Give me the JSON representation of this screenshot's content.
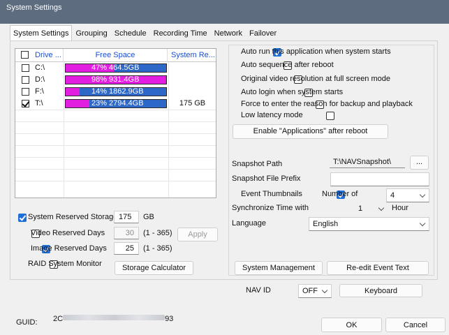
{
  "window": {
    "title": "System Settings"
  },
  "tabs": [
    {
      "label": "System Settings",
      "active": true
    },
    {
      "label": "Grouping"
    },
    {
      "label": "Schedule"
    },
    {
      "label": "Recording Time"
    },
    {
      "label": "Network"
    },
    {
      "label": "Failover"
    }
  ],
  "drive_table": {
    "headers": {
      "drive": "Drive ...",
      "free_space": "Free Space",
      "reserved": "System Re..."
    },
    "rows": [
      {
        "drive": "C:\\",
        "checked": false,
        "used_percent": 47,
        "percent_label": "47%",
        "size": "464.5GB",
        "reserved": ""
      },
      {
        "drive": "D:\\",
        "checked": false,
        "used_percent": 98,
        "percent_label": "98%",
        "size": "931.4GB",
        "reserved": ""
      },
      {
        "drive": "F:\\",
        "checked": false,
        "used_percent": 14,
        "percent_label": "14%",
        "size": "1862.9GB",
        "reserved": ""
      },
      {
        "drive": "T:\\",
        "checked": true,
        "used_percent": 23,
        "percent_label": "23%",
        "size": "2794.4GB",
        "reserved": "175 GB"
      }
    ],
    "colors": {
      "used": "#e21ee0",
      "free": "#2d67c8"
    }
  },
  "storage": {
    "system_reserved_label": "System Reserved Storage",
    "system_reserved_value": "175",
    "system_reserved_unit": "GB",
    "video_days_label": "Video Reserved Days",
    "video_days_value": "30",
    "video_days_range": "(1 - 365)",
    "apply_label": "Apply",
    "image_days_label": "Image Reserved Days",
    "image_days_value": "25",
    "image_days_range": "(1 - 365)",
    "raid_label": "RAID System Monitor",
    "calculator_label": "Storage Calculator"
  },
  "options": {
    "auto_run": "Auto run this application when system starts",
    "auto_sequence": "Auto sequence after reboot",
    "original_resolution": "Original video resolution at full screen mode",
    "auto_login": "Auto login when system starts",
    "force_reason": "Force to enter the reason for backup and playback",
    "low_latency": "Low latency mode",
    "enable_apps_button": "Enable \"Applications\" after reboot"
  },
  "snapshot": {
    "path_label": "Snapshot Path",
    "path_value": "T:\\NAVSnapshot\\",
    "browse_label": "...",
    "prefix_label": "Snapshot File Prefix",
    "prefix_value": ""
  },
  "thumbnails": {
    "label": "Event Thumbnails",
    "number_label": "Number of",
    "number_value": "4"
  },
  "sync": {
    "label": "Synchronize Time with",
    "value": "1",
    "unit": "Hour"
  },
  "language": {
    "label": "Language",
    "value": "English"
  },
  "bottom_panel": {
    "system_management": "System Management",
    "reedit_event_text": "Re-edit Event Text"
  },
  "nav_id": {
    "label": "NAV ID",
    "value": "OFF",
    "keyboard_label": "Keyboard"
  },
  "footer": {
    "guid_label": "GUID:",
    "guid_prefix": "2C",
    "guid_suffix": "93",
    "ok_label": "OK",
    "cancel_label": "Cancel"
  },
  "accent_color": "#1f6fd6"
}
